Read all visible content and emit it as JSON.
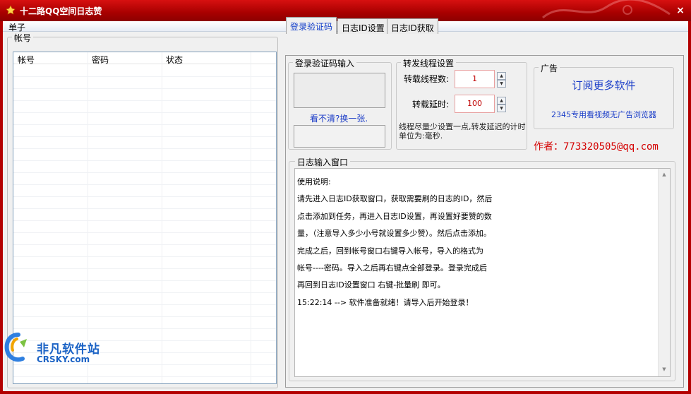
{
  "window": {
    "title": "十二路QQ空间日志赞",
    "close_glyph": "×"
  },
  "menu": {
    "items": [
      {
        "label": "单子"
      }
    ]
  },
  "accounts": {
    "legend": "帐号",
    "columns": [
      {
        "label": "帐号"
      },
      {
        "label": "密码"
      },
      {
        "label": "状态"
      }
    ]
  },
  "tabs": [
    {
      "label": "登录验证码",
      "active": true
    },
    {
      "label": "日志ID设置",
      "active": false
    },
    {
      "label": "日志ID获取",
      "active": false
    }
  ],
  "captcha": {
    "legend": "登录验证码输入",
    "refresh_link": "看不清?换一张."
  },
  "thread": {
    "legend": "转发线程设置",
    "threads_label": "转载线程数:",
    "threads_value": "1",
    "delay_label": "转载延时:",
    "delay_value": "100",
    "note": "线程尽量少设置一点,转发延迟的计时单位为:毫秒."
  },
  "ad": {
    "legend": "广告",
    "main": "订阅更多软件",
    "sub": "2345专用看视频无广告浏览器"
  },
  "author": "作者：773320505@qq.com",
  "log": {
    "legend": "日志输入窗口",
    "lines": [
      "使用说明:",
      "请先进入日志ID获取窗口，获取需要刷的日志的ID，然后",
      "点击添加到任务，再进入日志ID设置，再设置好要赞的数",
      "量，（注意导入多少小号就设置多少赞）。然后点击添加。",
      "完成之后，回到帐号窗口右键导入帐号，导入的格式为",
      "帐号----密码。导入之后再右键点全部登录。登录完成后",
      "再回到日志ID设置窗口 右键-批量刷 即可。",
      "15:22:14 --> 软件准备就绪！请导入后开始登录！"
    ]
  },
  "watermark": {
    "cn": "非凡软件站",
    "en": "CRSKY.com"
  },
  "colors": {
    "titlebar": "#b30000",
    "accent_link": "#1b3cc7",
    "author": "#d40000"
  }
}
